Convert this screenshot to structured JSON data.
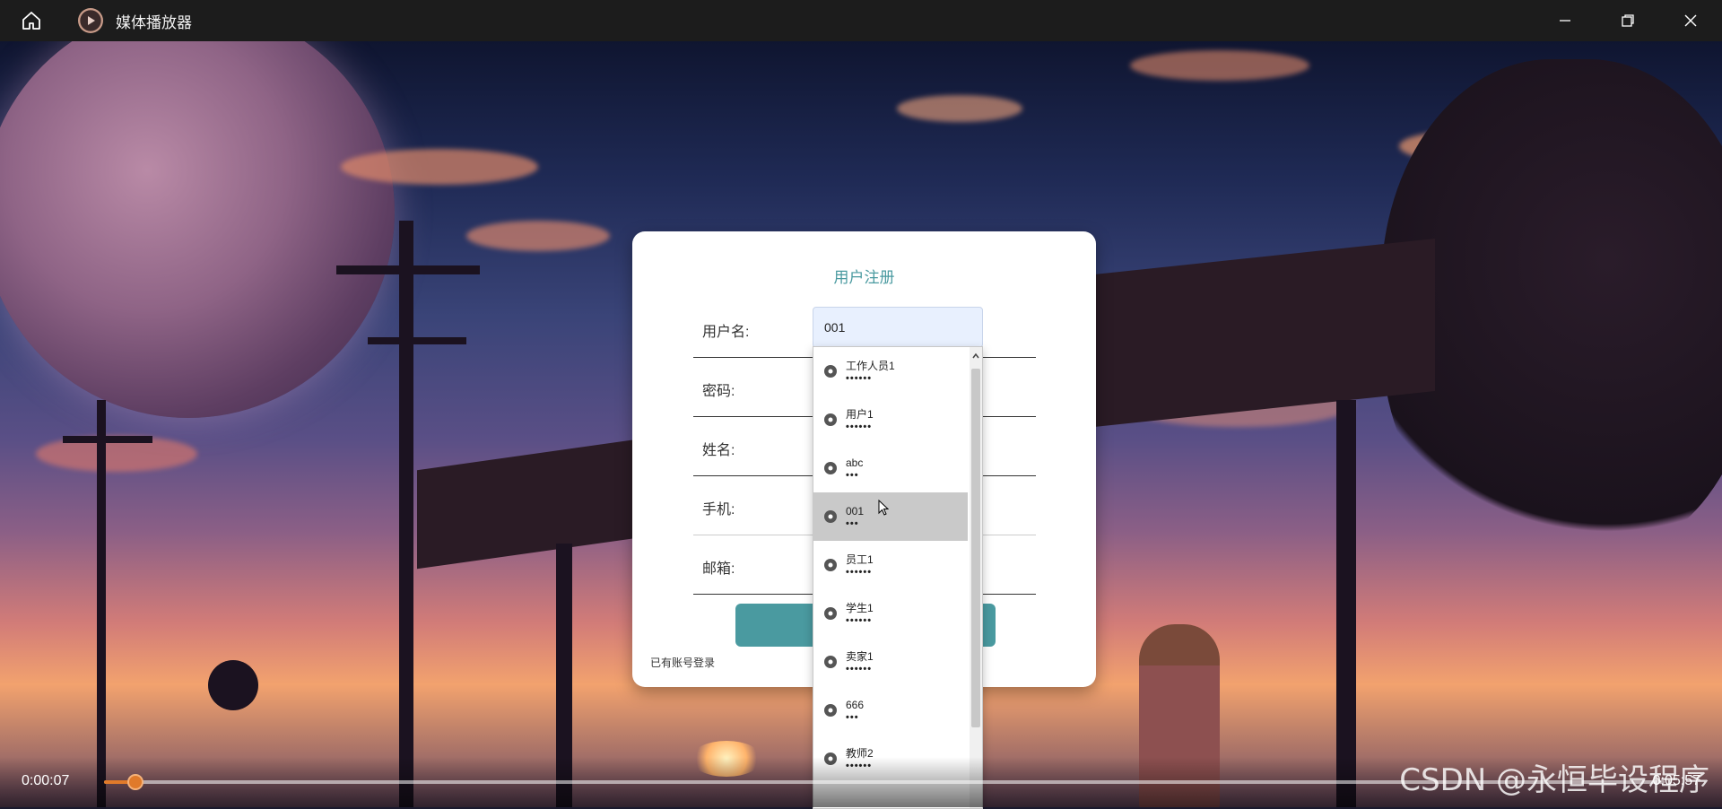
{
  "titlebar": {
    "title": "媒体播放器",
    "icons": {
      "home": "home-icon",
      "app": "play-circle-icon",
      "minimize": "minimize-icon",
      "restore": "restore-icon",
      "close": "close-icon"
    }
  },
  "modal": {
    "title": "用户注册",
    "fields": [
      {
        "label": "用户名:"
      },
      {
        "label": "密码:"
      },
      {
        "label": "姓名:"
      },
      {
        "label": "手机:"
      },
      {
        "label": "邮箱:"
      }
    ],
    "username_value": "001",
    "login_link": "已有账号登录",
    "accent_color": "#4a9aa0"
  },
  "autofill": {
    "items": [
      {
        "user": "工作人员1",
        "pass": "••••••"
      },
      {
        "user": "用户1",
        "pass": "••••••"
      },
      {
        "user": "abc",
        "pass": "•••"
      },
      {
        "user": "001",
        "pass": "•••"
      },
      {
        "user": "员工1",
        "pass": "••••••"
      },
      {
        "user": "学生1",
        "pass": "••••••"
      },
      {
        "user": "卖家1",
        "pass": "••••••"
      },
      {
        "user": "666",
        "pass": "•••"
      },
      {
        "user": "教师2",
        "pass": "••••••"
      }
    ],
    "hover_index": 3,
    "item_icon": "key-icon"
  },
  "player": {
    "current_time": "0:00:07",
    "total_time": "0:05:57",
    "progress_percent": 2,
    "accent_color": "#e07a2a"
  },
  "watermark": "CSDN @永恒毕设程序"
}
